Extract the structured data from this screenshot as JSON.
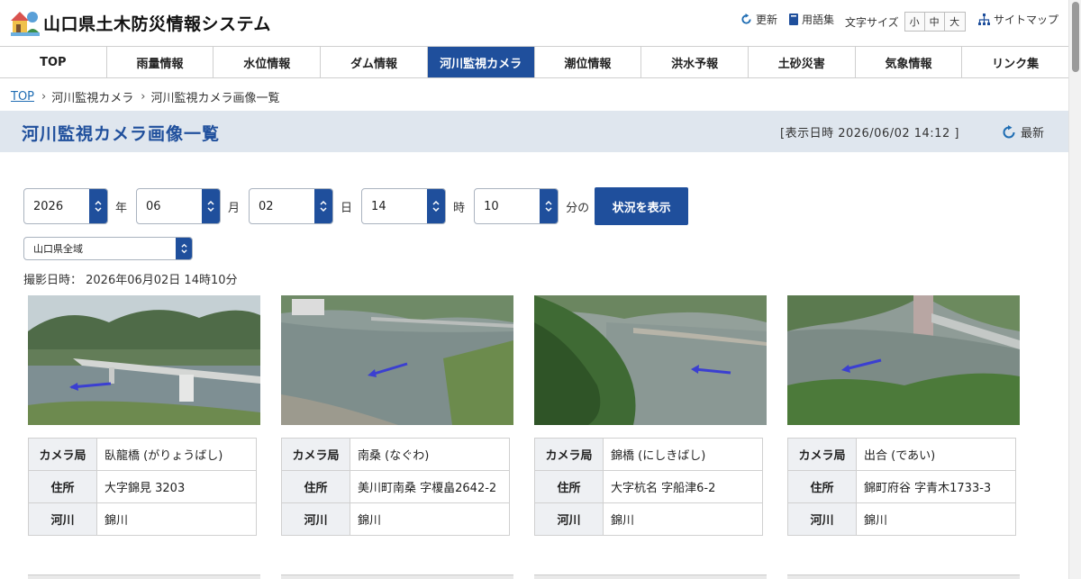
{
  "header": {
    "site_title": "山口県土木防災情報システム",
    "update_label": "更新",
    "glossary_label": "用語集",
    "font_size_label": "文字サイズ",
    "font_sizes": [
      "小",
      "中",
      "大"
    ],
    "sitemap_label": "サイトマップ"
  },
  "nav": {
    "items": [
      "TOP",
      "雨量情報",
      "水位情報",
      "ダム情報",
      "河川監視カメラ",
      "潮位情報",
      "洪水予報",
      "土砂災害",
      "気象情報",
      "リンク集"
    ],
    "active_index": 4
  },
  "breadcrumb": {
    "items": [
      "TOP",
      "河川監視カメラ",
      "河川監視カメラ画像一覧"
    ]
  },
  "page": {
    "title": "河川監視カメラ画像一覧",
    "display_time": "[表示日時 2026/06/02 14:12 ]",
    "latest_label": "最新"
  },
  "form": {
    "year": "2026",
    "year_unit": "年",
    "month": "06",
    "month_unit": "月",
    "day": "02",
    "day_unit": "日",
    "hour": "14",
    "hour_unit": "時",
    "minute": "10",
    "minute_unit": "分の",
    "submit_label": "状況を表示",
    "area": "山口県全域"
  },
  "shot_time": "撮影日時：  2026年06月02日 14時10分",
  "cameras": [
    {
      "station_label": "カメラ局",
      "station": "臥龍橋 (がりょうばし)",
      "address_label": "住所",
      "address": "大字錦見 3203",
      "river_label": "河川",
      "river": "錦川"
    },
    {
      "station_label": "カメラ局",
      "station": "南桑 (なぐわ)",
      "address_label": "住所",
      "address": "美川町南桑 字榎畠2642-2",
      "river_label": "河川",
      "river": "錦川"
    },
    {
      "station_label": "カメラ局",
      "station": "錦橋 (にしきばし)",
      "address_label": "住所",
      "address": "大字杭名 字船津6-2",
      "river_label": "河川",
      "river": "錦川"
    },
    {
      "station_label": "カメラ局",
      "station": "出合 (であい)",
      "address_label": "住所",
      "address": "錦町府谷 字青木1733-3",
      "river_label": "河川",
      "river": "錦川"
    }
  ],
  "colors": {
    "primary": "#1f4f9c",
    "band": "#dfe6ee",
    "flow_arrow": "#3b3fd1"
  },
  "icons": {
    "update": "refresh-icon",
    "glossary": "book-icon",
    "sitemap": "sitemap-icon",
    "latest": "refresh-icon"
  }
}
